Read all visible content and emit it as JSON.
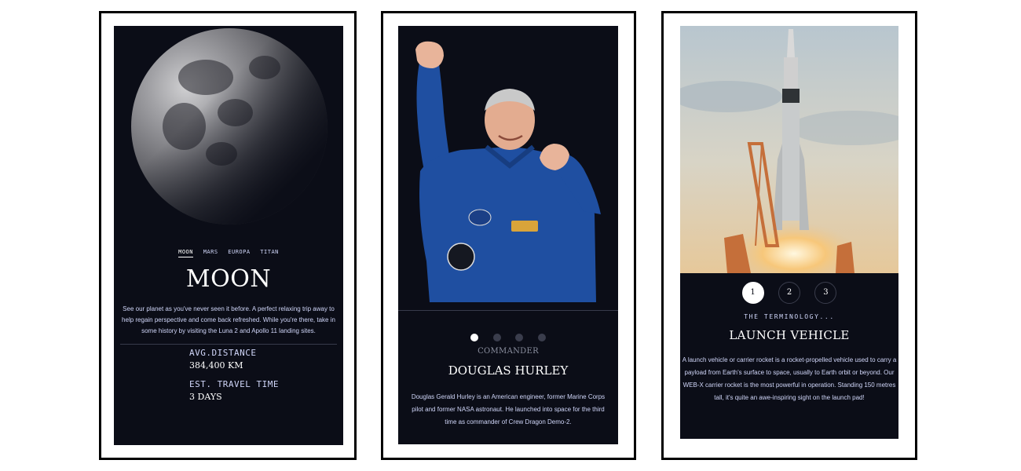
{
  "destination": {
    "tabs": [
      "MOON",
      "MARS",
      "EUROPA",
      "TITAN"
    ],
    "active_tab": "MOON",
    "title": "MOON",
    "description": "See our planet as you've never seen it before. A perfect relaxing trip away to help regain perspective and come back refreshed. While you're there, take in some history by visiting the Luna 2 and Apollo 11 landing sites.",
    "stats": {
      "distance_label": "AVG.DISTANCE",
      "distance_value": "384,400 KM",
      "travel_label": "EST. TRAVEL TIME",
      "travel_value": "3 DAYS"
    }
  },
  "crew": {
    "pagination_dots": 4,
    "active_dot": 1,
    "role": "COMMANDER",
    "name": "DOUGLAS HURLEY",
    "bio": "Douglas Gerald Hurley is an American engineer, former Marine Corps pilot and former NASA astronaut. He launched into space for the third time as commander of Crew Dragon Demo-2."
  },
  "technology": {
    "steps": [
      "1",
      "2",
      "3"
    ],
    "active_step": "1",
    "term_label": "THE TERMINOLOGY...",
    "title": "LAUNCH VEHICLE",
    "description": "A launch vehicle or carrier rocket is a rocket-propelled vehicle used to carry a payload from Earth's surface to space, usually to Earth orbit or beyond. Our WEB-X carrier rocket is the most powerful in operation. Standing 150 metres tall, it's quite an awe-inspiring sight on the launch pad!"
  },
  "colors": {
    "background": "#0b0d17",
    "accent_text": "#d0d6f9",
    "white": "#ffffff"
  }
}
